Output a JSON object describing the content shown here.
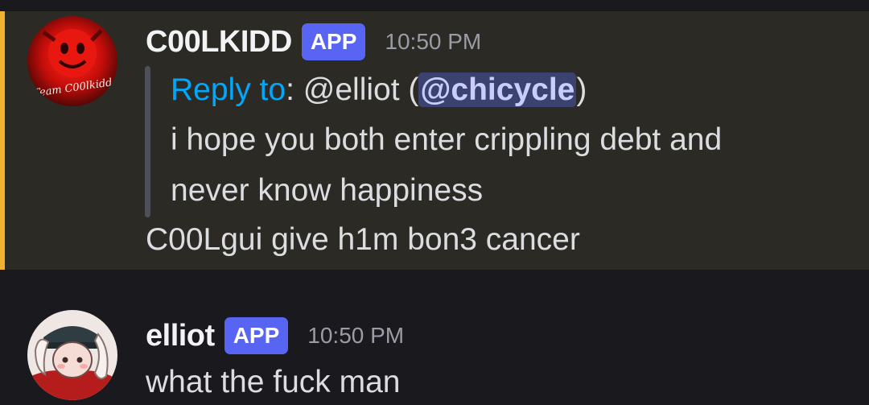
{
  "messages": [
    {
      "username": "C00LKIDD",
      "badge": "APP",
      "timestamp": "10:50 PM",
      "highlighted": true,
      "reply": {
        "label": "Reply to",
        "colon": ":",
        "prefix": " @elliot (",
        "mention": "@chicycle",
        "suffix": ")",
        "line2": "i hope you both enter crippling debt and",
        "line3": "never know happiness"
      },
      "text": "C00Lgui give h1m bon3 cancer"
    },
    {
      "username": "elliot",
      "badge": "APP",
      "timestamp": "10:50 PM",
      "highlighted": false,
      "text": "what the fuck man"
    }
  ],
  "colors": {
    "background": "#1a1a1e",
    "highlight_bg": "#2b2a25",
    "accent_bar": "#f0b232",
    "badge": "#5865f2",
    "reply_link": "#00a8fc",
    "mention_bg": "#3c4270"
  },
  "icons": {
    "avatar_1": "red-avatar-icon",
    "avatar_2": "drawn-character-avatar-icon"
  }
}
